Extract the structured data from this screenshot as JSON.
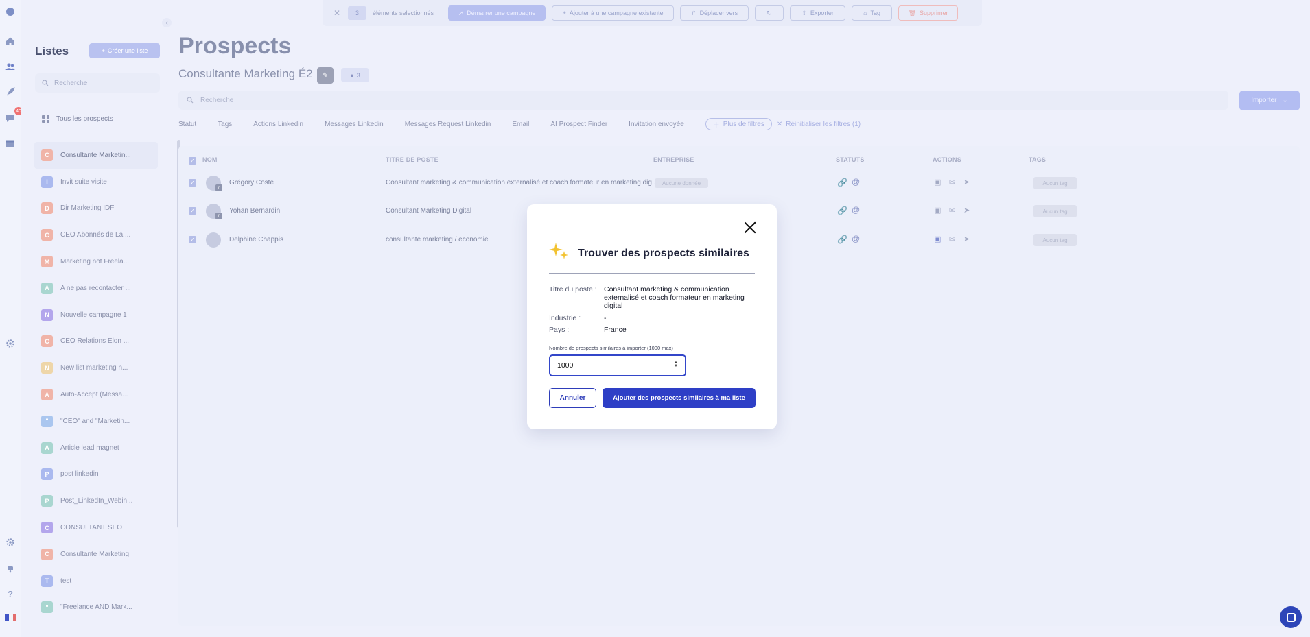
{
  "rail": {
    "icons": [
      "logo-icon",
      "home-icon",
      "users-icon",
      "rocket-icon",
      "chat-icon",
      "calendar-icon",
      "settings-icon",
      "gear-icon",
      "bell-icon",
      "help-icon",
      "flag-icon"
    ],
    "messages_badge": "40"
  },
  "sidebar": {
    "title": "Listes",
    "create_label": "Créer une liste",
    "search_placeholder": "Recherche",
    "all_prospects": "Tous les prospects",
    "items": [
      {
        "letter": "C",
        "label": "Consultante Marketin...",
        "color": "#f0b4a8"
      },
      {
        "letter": "I",
        "label": "Invit suite visite",
        "color": "#aab9ef"
      },
      {
        "letter": "D",
        "label": "Dir Marketing IDF",
        "color": "#f0b4a8"
      },
      {
        "letter": "C",
        "label": "CEO Abonnés de La ...",
        "color": "#f0b4a8"
      },
      {
        "letter": "M",
        "label": "Marketing not Freela...",
        "color": "#f0b4a8"
      },
      {
        "letter": "A",
        "label": "A ne pas recontacter ...",
        "color": "#a9d6d0"
      },
      {
        "letter": "N",
        "label": "Nouvelle campagne 1",
        "color": "#b3a6ec"
      },
      {
        "letter": "C",
        "label": "CEO Relations Elon ...",
        "color": "#f0b4a8"
      },
      {
        "letter": "N",
        "label": "New list marketing n...",
        "color": "#eed6a9"
      },
      {
        "letter": "A",
        "label": "Auto-Accept (Messa...",
        "color": "#f0b4a8"
      },
      {
        "letter": "\"",
        "label": "\"CEO\" and \"Marketin...",
        "color": "#aac6ef"
      },
      {
        "letter": "A",
        "label": "Article lead magnet",
        "color": "#a9d6d0"
      },
      {
        "letter": "P",
        "label": "post linkedin",
        "color": "#aab9ef"
      },
      {
        "letter": "P",
        "label": "Post_LinkedIn_Webin...",
        "color": "#a9d6d0"
      },
      {
        "letter": "C",
        "label": "CONSULTANT SEO",
        "color": "#b3a6ec"
      },
      {
        "letter": "C",
        "label": "Consultante Marketing",
        "color": "#f0b4a8"
      },
      {
        "letter": "T",
        "label": "test",
        "color": "#aab9ef"
      },
      {
        "letter": "\"",
        "label": "\"Freelance AND Mark...",
        "color": "#a9d6d0"
      }
    ]
  },
  "topbar": {
    "count": "3",
    "selected_label": "éléments selectionnés",
    "start_campaign": "Démarrer une campagne",
    "add_existing": "Ajouter à une campagne existante",
    "move_to": "Déplacer vers",
    "export": "Exporter",
    "tag": "Tag",
    "delete": "Supprimer"
  },
  "main": {
    "title": "Prospects",
    "list_name": "Consultante Marketing É2",
    "members_count": "3",
    "search_placeholder": "Recherche",
    "import_label": "Importer",
    "filters": [
      "Statut",
      "Tags",
      "Actions Linkedin",
      "Messages Linkedin",
      "Messages Request Linkedin",
      "Email",
      "AI Prospect Finder",
      "Invitation envoyée"
    ],
    "more_filters": "Plus de filtres",
    "reset_filters": "Réinitialiser les filtres (1)"
  },
  "table": {
    "columns": [
      "NOM",
      "TITRE DE POSTE",
      "ENTREPRISE",
      "STATUTS",
      "ACTIONS",
      "TAGS"
    ],
    "rows": [
      {
        "name": "Grégory Coste",
        "title": "Consultant marketing & communication externalisé et coach formateur en marketing dig...",
        "company": "Aucune donnée",
        "tag": "Aucun tag"
      },
      {
        "name": "Yohan Bernardin",
        "title": "Consultant Marketing Digital",
        "company": "",
        "tag": "Aucun tag"
      },
      {
        "name": "Delphine Chappis",
        "title": "consultante marketing / economie",
        "company": "",
        "tag": "Aucun tag"
      }
    ]
  },
  "modal": {
    "title": "Trouver des prospects similaires",
    "job_label": "Titre du poste :",
    "job_value": "Consultant marketing & communication externalisé et coach formateur en marketing digital",
    "industry_label": "Industrie :",
    "industry_value": "-",
    "country_label": "Pays :",
    "country_value": "France",
    "qty_label": "Nombre de prospects similaires à importer (1000 max)",
    "qty_value": "1000",
    "cancel": "Annuler",
    "submit": "Ajouter des prospects similaires à ma liste"
  }
}
